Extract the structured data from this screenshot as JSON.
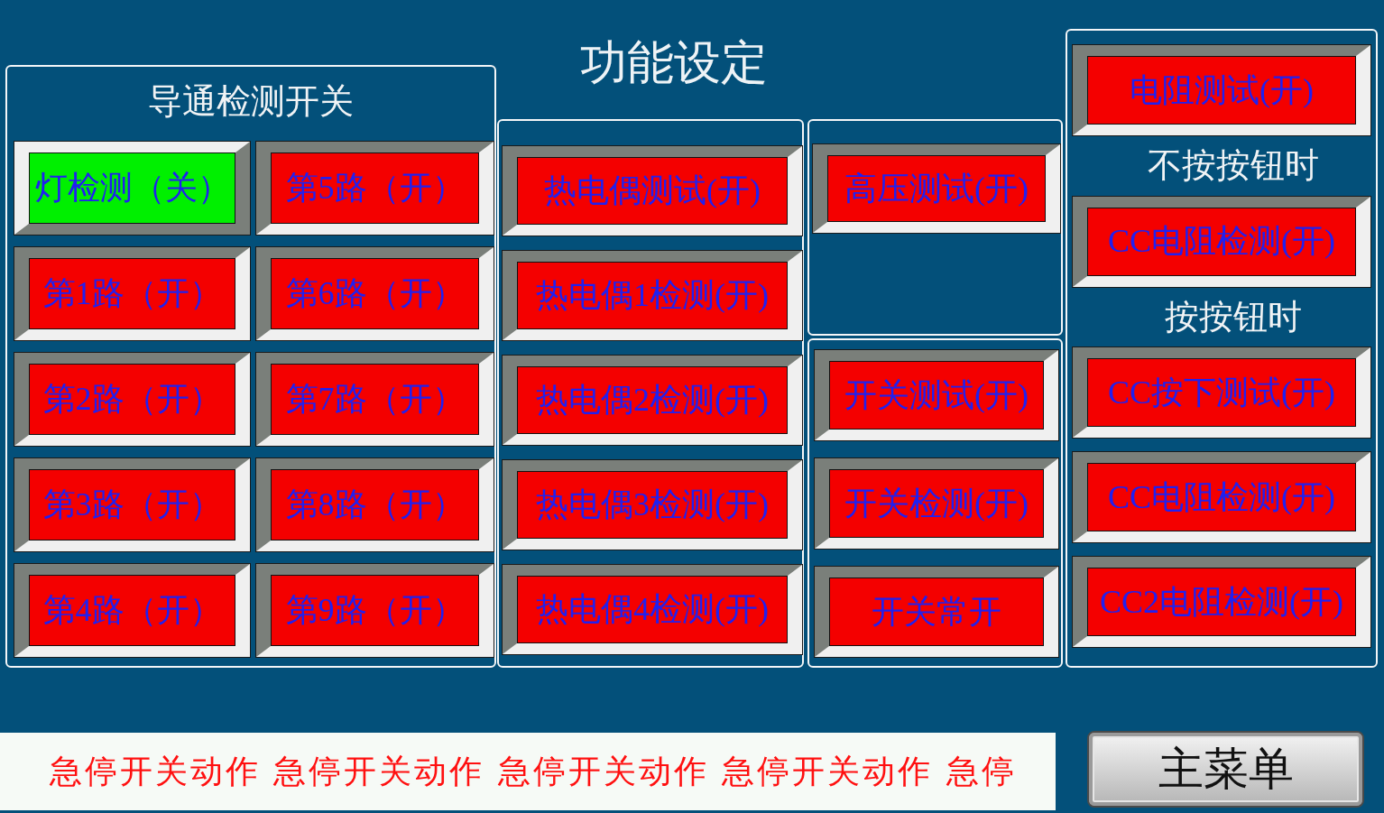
{
  "title": "功能设定",
  "panels": [
    {
      "title": "导通检测开关",
      "kind": "grid",
      "items": [
        {
          "kind": "button",
          "label": "灯检测（关）",
          "on": false
        },
        {
          "kind": "button",
          "label": "第5路（开）",
          "on": true
        },
        {
          "kind": "button",
          "label": "第1路（开）",
          "on": true
        },
        {
          "kind": "button",
          "label": "第6路（开）",
          "on": true
        },
        {
          "kind": "button",
          "label": "第2路（开）",
          "on": true
        },
        {
          "kind": "button",
          "label": "第7路（开）",
          "on": true
        },
        {
          "kind": "button",
          "label": "第3路（开）",
          "on": true
        },
        {
          "kind": "button",
          "label": "第8路（开）",
          "on": true
        },
        {
          "kind": "button",
          "label": "第4路（开）",
          "on": true
        },
        {
          "kind": "button",
          "label": "第9路（开）",
          "on": true
        }
      ]
    },
    {
      "kind": "column",
      "items": [
        {
          "kind": "button",
          "label": "热电偶测试(开)",
          "on": true
        },
        {
          "kind": "button",
          "label": "热电偶1检测(开)",
          "on": true
        },
        {
          "kind": "button",
          "label": "热电偶2检测(开)",
          "on": true
        },
        {
          "kind": "button",
          "label": "热电偶3检测(开)",
          "on": true
        },
        {
          "kind": "button",
          "label": "热电偶4检测(开)",
          "on": true
        }
      ]
    },
    {
      "kind": "column",
      "items": [
        {
          "kind": "button",
          "label": "高压测试(开)",
          "on": true
        }
      ]
    },
    {
      "kind": "column",
      "items": [
        {
          "kind": "button",
          "label": "开关测试(开)",
          "on": true
        },
        {
          "kind": "button",
          "label": "开关检测(开)",
          "on": true
        },
        {
          "kind": "button",
          "label": "开关常开",
          "on": true
        }
      ]
    },
    {
      "kind": "column",
      "items": [
        {
          "kind": "button",
          "label": "电阻测试(开)",
          "on": true
        },
        {
          "kind": "label",
          "label": "不按按钮时"
        },
        {
          "kind": "button",
          "label": "CC电阻检测(开)",
          "on": true
        },
        {
          "kind": "label",
          "label": "按按钮时"
        },
        {
          "kind": "button",
          "label": "CC按下测试(开)",
          "on": true
        },
        {
          "kind": "button",
          "label": "CC电阻检测(开)",
          "on": true
        },
        {
          "kind": "button",
          "label": "CC2电阻检测(开)",
          "on": true
        }
      ]
    }
  ],
  "marquee": {
    "text": "急停开关动作 急停开关动作 急停开关动作 急停开关动作 急停"
  },
  "menu_button": {
    "label": "主菜单"
  }
}
